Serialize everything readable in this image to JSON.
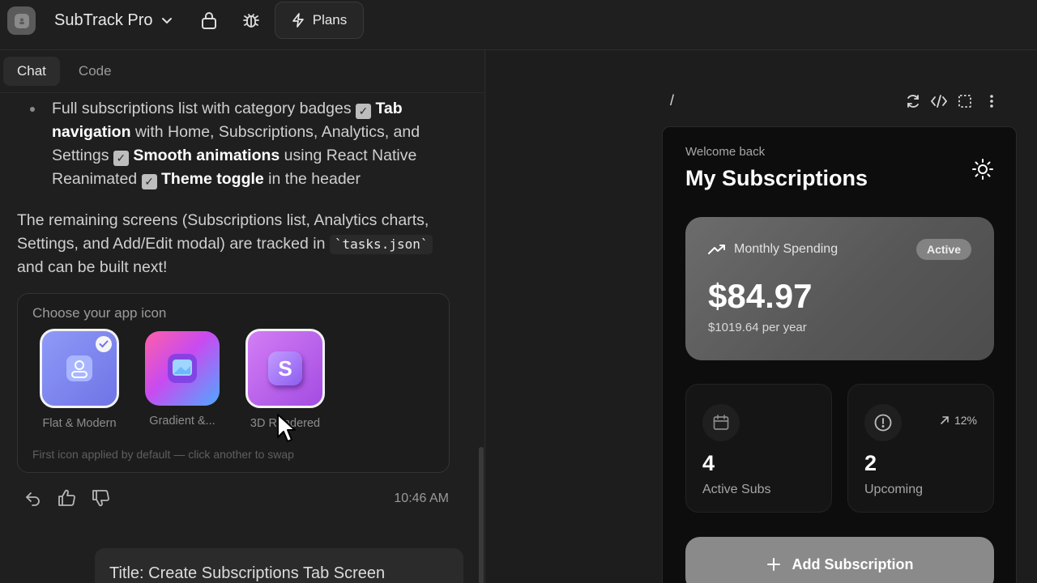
{
  "topbar": {
    "project_name": "SubTrack Pro",
    "plans_label": "Plans"
  },
  "left": {
    "tabs": [
      {
        "label": "Chat",
        "active": true
      },
      {
        "label": "Code",
        "active": false
      }
    ],
    "bullet": {
      "t1": "Full subscriptions list with category badges ",
      "b1": "Tab navigation",
      "t2": " with Home, Subscriptions, Analytics, and Settings ",
      "b2": "Smooth animations",
      "t3": " using React Native Reanimated ",
      "b3": "Theme toggle",
      "t4": " in the header",
      "check": "✓"
    },
    "paragraph": {
      "before": "The remaining screens (Subscriptions list, Analytics charts, Settings, and Add/Edit modal) are tracked in ",
      "code": "`tasks.json`",
      "after": " and can be built next!"
    },
    "icon_picker": {
      "title": "Choose your app icon",
      "options": [
        {
          "label": "Flat & Modern",
          "selected": true
        },
        {
          "label": "Gradient &...",
          "selected": false
        },
        {
          "label": "3D Rendered",
          "selected": false
        }
      ],
      "footnote": "First icon applied by default — click another to swap",
      "badge_letter": "S"
    },
    "message_time": "10:46 AM",
    "next_message": "Title: Create Subscriptions Tab Screen"
  },
  "right": {
    "path": "/",
    "preview": {
      "welcome": "Welcome back",
      "title": "My Subscriptions",
      "spending": {
        "label": "Monthly Spending",
        "badge": "Active",
        "amount": "$84.97",
        "per_year": "$1019.64 per year"
      },
      "stats": [
        {
          "value": "4",
          "label": "Active Subs",
          "icon": "calendar-icon"
        },
        {
          "value": "2",
          "label": "Upcoming",
          "icon": "alert-circle-icon",
          "trend": "12%"
        }
      ],
      "add_button": "Add Subscription"
    }
  },
  "colors": {
    "background": "#1f1f1f",
    "panel": "#1d1d1d",
    "phone": "#0d0d0d",
    "flat_icon": "#7d86f0",
    "gradient_icon": "#e94bd8",
    "rendered_icon": "#b85ae6"
  }
}
